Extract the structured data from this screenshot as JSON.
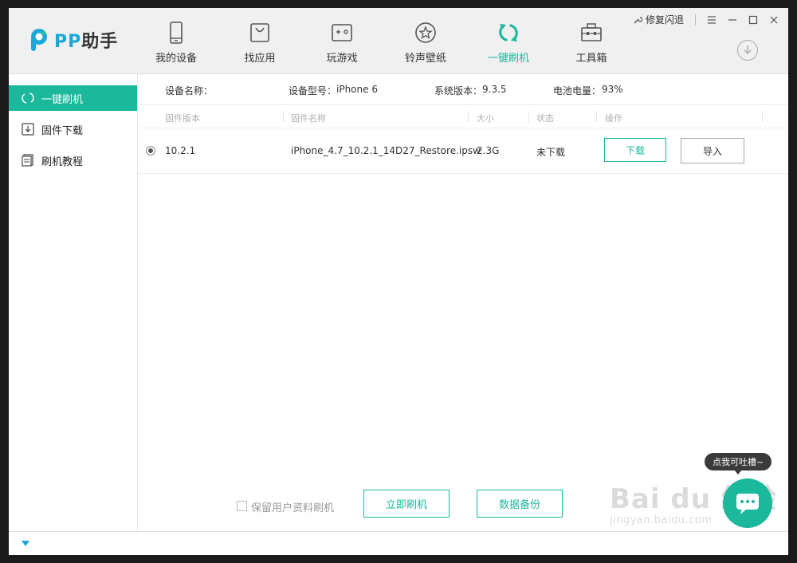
{
  "app": {
    "logo_pp": "PP",
    "logo_text": "助手"
  },
  "nav": {
    "items": [
      {
        "label": "我的设备",
        "icon": "phone-icon"
      },
      {
        "label": "找应用",
        "icon": "bag-icon"
      },
      {
        "label": "玩游戏",
        "icon": "gamepad-icon"
      },
      {
        "label": "铃声壁纸",
        "icon": "star-icon"
      },
      {
        "label": "一键刷机",
        "icon": "refresh-icon",
        "active": true
      },
      {
        "label": "工具箱",
        "icon": "toolbox-icon"
      }
    ]
  },
  "window_controls": {
    "repair_label": "修复闪退"
  },
  "sidebar": {
    "items": [
      {
        "label": "一键刷机",
        "icon": "refresh-icon",
        "active": true
      },
      {
        "label": "固件下载",
        "icon": "download-icon"
      },
      {
        "label": "刷机教程",
        "icon": "document-icon"
      }
    ]
  },
  "device": {
    "name_label": "设备名称：",
    "model_label": "设备型号：",
    "model_value": "iPhone 6",
    "version_label": "系统版本：",
    "version_value": "9.3.5",
    "battery_label": "电池电量：",
    "battery_value": "93%"
  },
  "table": {
    "headers": [
      "固件版本",
      "固件名称",
      "大小",
      "状态",
      "操作"
    ],
    "rows": [
      {
        "version": "10.2.1",
        "name": "iPhone_4.7_10.2.1_14D27_Restore.ipsw",
        "size": "2.3G",
        "status": "未下载",
        "download_label": "下载",
        "import_label": "导入"
      }
    ]
  },
  "bottom": {
    "keep_data_label": "保留用户资料刷机",
    "flash_button": "立即刷机",
    "backup_button": "数据备份"
  },
  "feedback": {
    "tooltip": "点我可吐槽~"
  },
  "watermark": {
    "main": "Bai du 经验",
    "sub": "jingyan.baidu.com"
  },
  "colors": {
    "accent": "#1bb89c",
    "logo_blue": "#1aa8d8"
  }
}
